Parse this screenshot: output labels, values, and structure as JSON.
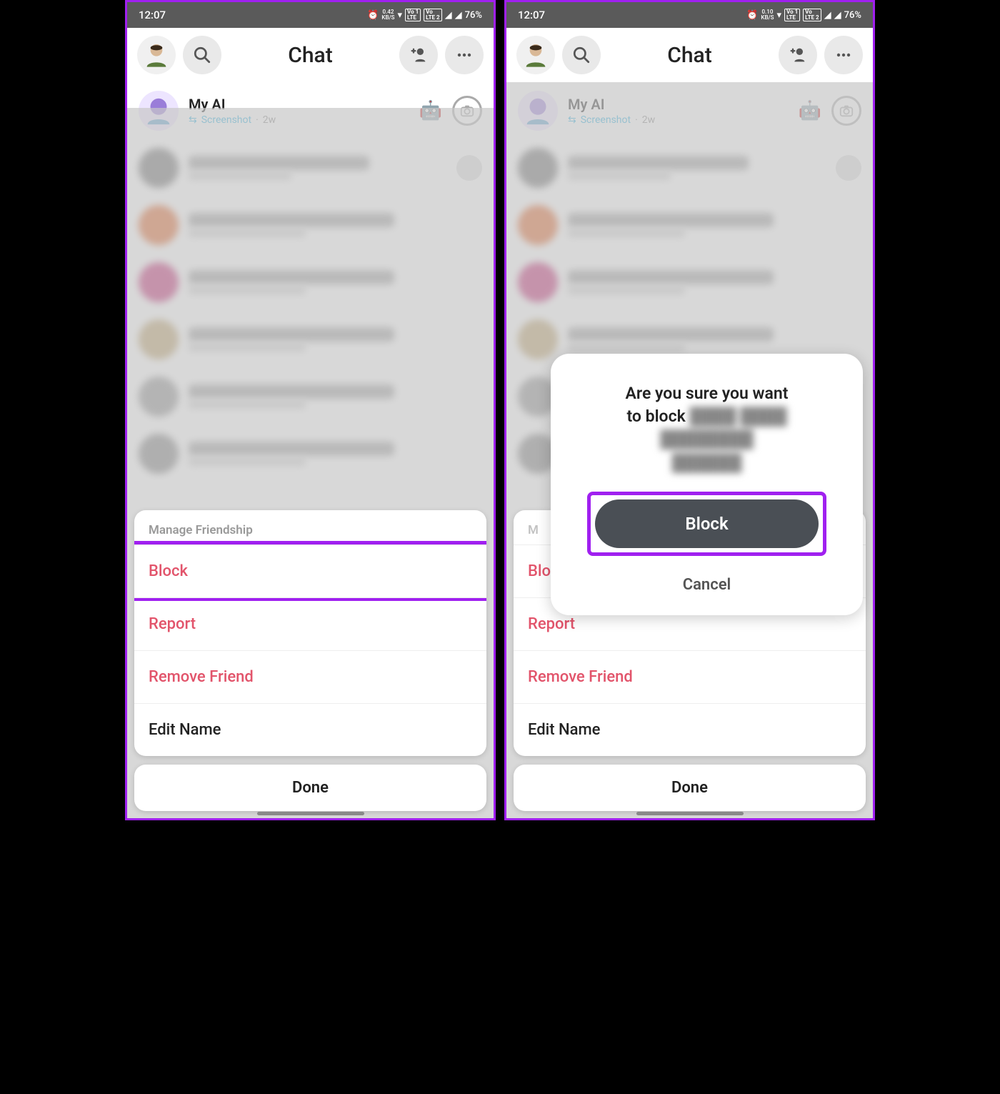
{
  "status": {
    "time": "12:07",
    "kbs_left": "0.42",
    "kbs_right": "0.10",
    "kbs_unit": "KB/S",
    "lte1": "VoLTE 1",
    "lte2": "LTE 2",
    "battery": "76%"
  },
  "header": {
    "title": "Chat"
  },
  "chat": {
    "myai_name": "My AI",
    "myai_sub_action": "Screenshot",
    "myai_sub_time": "2w"
  },
  "sheet": {
    "title": "Manage Friendship",
    "block": "Block",
    "report": "Report",
    "remove": "Remove Friend",
    "edit": "Edit Name",
    "done": "Done"
  },
  "dialog": {
    "line1": "Are you sure you want",
    "line2_prefix": "to block",
    "block": "Block",
    "cancel": "Cancel"
  }
}
